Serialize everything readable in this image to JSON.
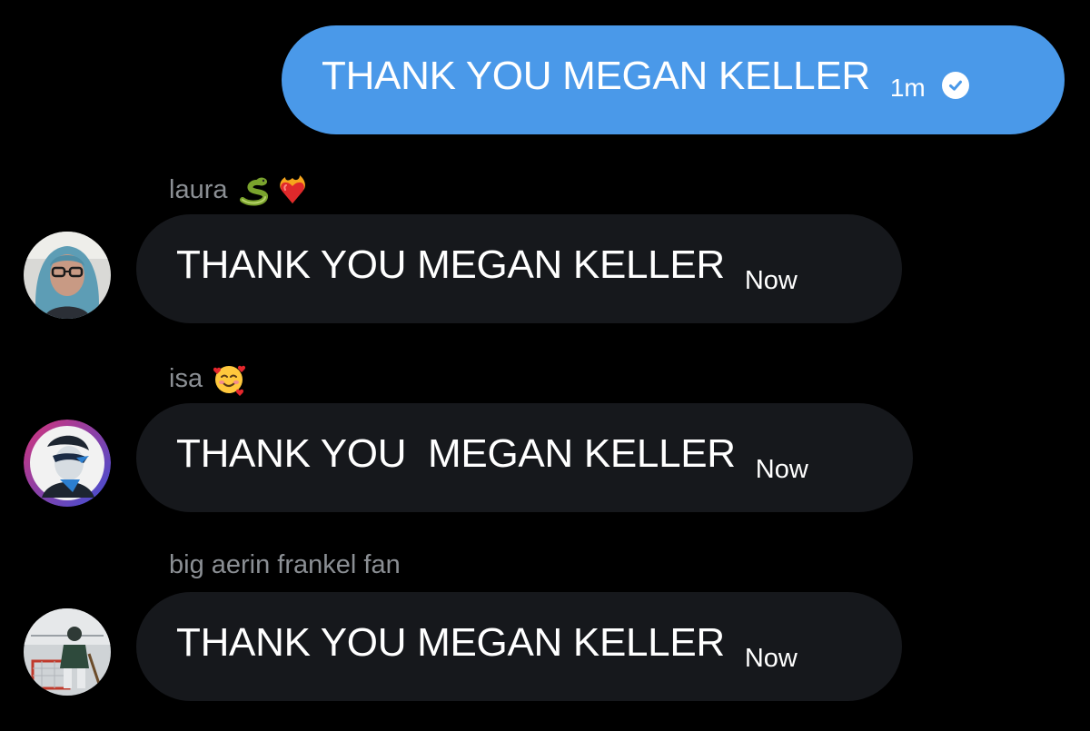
{
  "colors": {
    "background": "#000000",
    "outgoing_bubble": "#4a99e9",
    "incoming_bubble": "#16181c",
    "sender_name": "#8b8f94",
    "message_text": "#ffffff"
  },
  "outgoing": {
    "text": "THANK YOU MEGAN KELLER",
    "time": "1m",
    "status_icon": "check-circle-icon"
  },
  "messages": [
    {
      "sender": "laura",
      "emojis": [
        "snake-emoji",
        "heart-on-fire-emoji"
      ],
      "text": "THANK YOU MEGAN KELLER",
      "time": "Now",
      "avatar": "avatar-blue-hair-glasses"
    },
    {
      "sender": "isa",
      "emojis": [
        "smiling-face-with-hearts-emoji"
      ],
      "text": "THANK YOU  MEGAN KELLER",
      "time": "Now",
      "avatar": "avatar-comic-character"
    },
    {
      "sender": "big aerin frankel fan",
      "emojis": [],
      "text": "THANK YOU MEGAN KELLER",
      "time": "Now",
      "avatar": "avatar-hockey-goalie"
    }
  ]
}
